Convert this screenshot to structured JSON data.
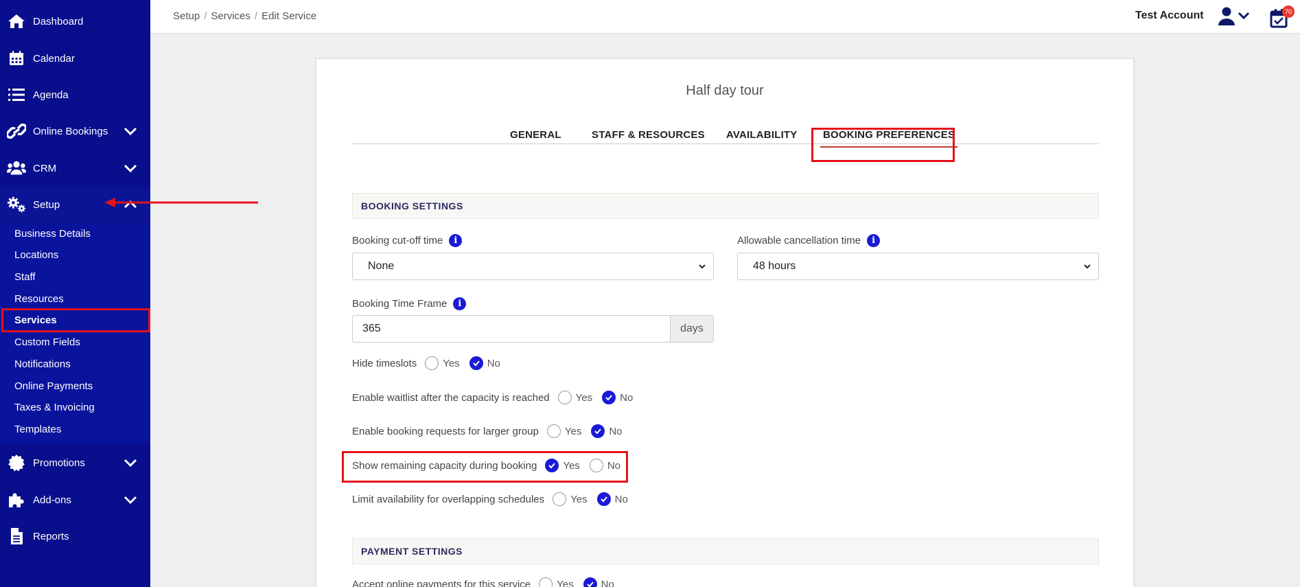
{
  "sidebar": {
    "items": [
      {
        "label": "Dashboard"
      },
      {
        "label": "Calendar"
      },
      {
        "label": "Agenda"
      },
      {
        "label": "Online Bookings"
      },
      {
        "label": "CRM"
      },
      {
        "label": "Setup"
      },
      {
        "label": "Promotions"
      },
      {
        "label": "Add-ons"
      },
      {
        "label": "Reports"
      }
    ],
    "setup_sub": [
      {
        "label": "Business Details"
      },
      {
        "label": "Locations"
      },
      {
        "label": "Staff"
      },
      {
        "label": "Resources"
      },
      {
        "label": "Services"
      },
      {
        "label": "Custom Fields"
      },
      {
        "label": "Notifications"
      },
      {
        "label": "Online Payments"
      },
      {
        "label": "Taxes & Invoicing"
      },
      {
        "label": "Templates"
      }
    ]
  },
  "header": {
    "breadcrumb": [
      "Setup",
      "Services",
      "Edit Service"
    ],
    "account": "Test Account",
    "badge_count": "70"
  },
  "card": {
    "title": "Half day tour",
    "tabs": [
      {
        "label": "GENERAL"
      },
      {
        "label": "STAFF & RESOURCES"
      },
      {
        "label": "AVAILABILITY"
      },
      {
        "label": "BOOKING PREFERENCES"
      }
    ],
    "booking_settings": {
      "heading": "BOOKING SETTINGS",
      "cutoff_label": "Booking cut-off time",
      "cutoff_value": "None",
      "cancel_label": "Allowable cancellation time",
      "cancel_value": "48 hours",
      "timeframe_label": "Booking Time Frame",
      "timeframe_value": "365",
      "timeframe_unit": "days",
      "options": [
        {
          "label": "Hide timeslots",
          "yes": "Yes",
          "no": "No",
          "selected": "No"
        },
        {
          "label": "Enable waitlist after the capacity is reached",
          "yes": "Yes",
          "no": "No",
          "selected": "No"
        },
        {
          "label": "Enable booking requests for larger group",
          "yes": "Yes",
          "no": "No",
          "selected": "No"
        },
        {
          "label": "Show remaining capacity during booking",
          "yes": "Yes",
          "no": "No",
          "selected": "Yes"
        },
        {
          "label": "Limit availability for overlapping schedules",
          "yes": "Yes",
          "no": "No",
          "selected": "No"
        }
      ]
    },
    "payment_settings": {
      "heading": "PAYMENT SETTINGS",
      "online_payments": {
        "label": "Accept online payments for this service",
        "yes": "Yes",
        "no": "No",
        "selected": "No"
      }
    }
  },
  "colors": {
    "sidebar": "#080e8c",
    "accent": "#1a1ad6",
    "highlight": "#e4121a"
  }
}
